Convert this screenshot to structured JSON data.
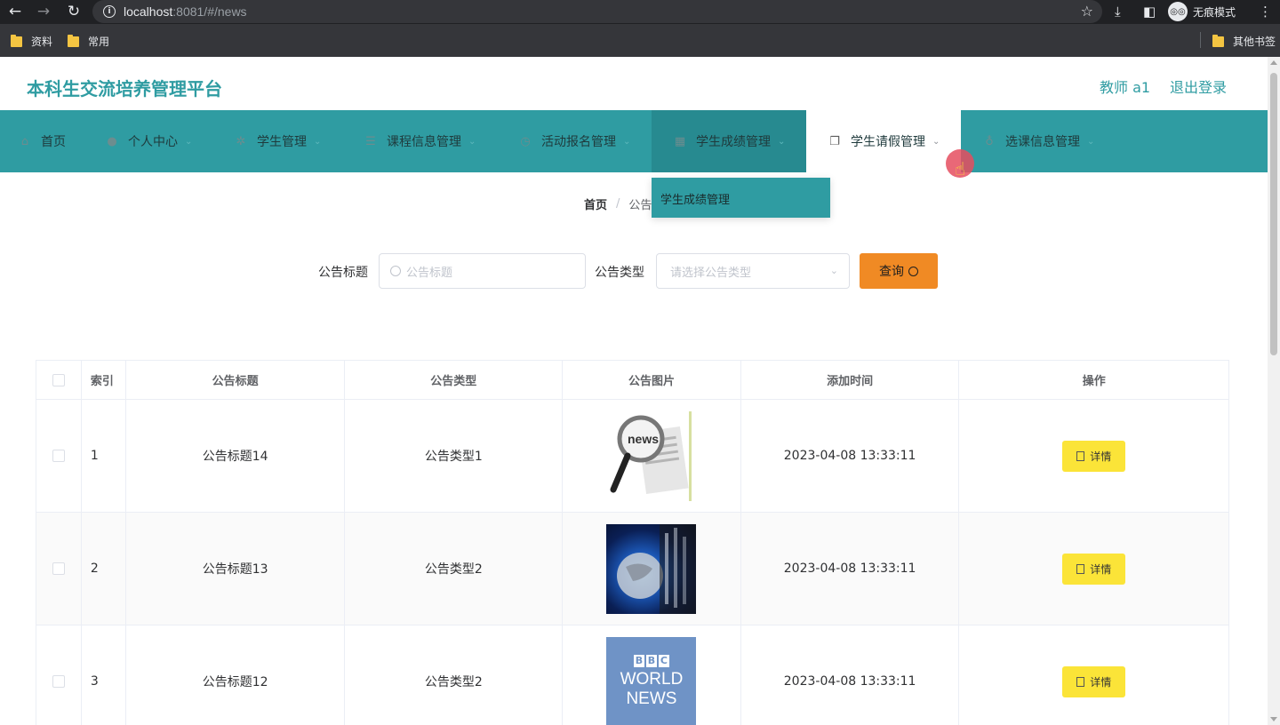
{
  "browser": {
    "url_host": "localhost",
    "url_port": ":8081/#/news",
    "incognito_label": "无痕模式",
    "bookmarks": [
      "资料",
      "常用"
    ],
    "other_bookmarks": "其他书签"
  },
  "header": {
    "site_title": "本科生交流培养管理平台",
    "user": "教师 a1",
    "logout": "退出登录"
  },
  "nav": {
    "items": [
      {
        "label": "首页",
        "icon": "home-icon"
      },
      {
        "label": "个人中心",
        "icon": "user-icon"
      },
      {
        "label": "学生管理",
        "icon": "compass-icon"
      },
      {
        "label": "课程信息管理",
        "icon": "list-icon"
      },
      {
        "label": "活动报名管理",
        "icon": "clock-icon"
      },
      {
        "label": "学生成绩管理",
        "icon": "grid-icon"
      },
      {
        "label": "学生请假管理",
        "icon": "copy-icon"
      },
      {
        "label": "选课信息管理",
        "icon": "mic-icon"
      }
    ],
    "dropdown_item": "学生成绩管理"
  },
  "breadcrumb": {
    "home": "首页",
    "sep": "/",
    "current": "公告"
  },
  "search": {
    "title_label": "公告标题",
    "title_placeholder": "公告标题",
    "type_label": "公告类型",
    "type_placeholder": "请选择公告类型",
    "query_button": "查询"
  },
  "table": {
    "headers": [
      "索引",
      "公告标题",
      "公告类型",
      "公告图片",
      "添加时间",
      "操作"
    ],
    "rows": [
      {
        "index": "1",
        "title": "公告标题14",
        "type": "公告类型1",
        "image": "news-magnifier",
        "time": "2023-04-08 13:33:11",
        "action": "详情"
      },
      {
        "index": "2",
        "title": "公告标题13",
        "type": "公告类型2",
        "image": "globe",
        "time": "2023-04-08 13:33:11",
        "action": "详情"
      },
      {
        "index": "3",
        "title": "公告标题12",
        "type": "公告类型2",
        "image": "bbc-world-news",
        "time": "2023-04-08 13:33:11",
        "action": "详情"
      }
    ],
    "bbc_letters": [
      "B",
      "B",
      "C"
    ],
    "bbc_line1": "WORLD",
    "bbc_line2": "NEWS",
    "news_paper_text": "news"
  },
  "colors": {
    "brand": "#2f9ca2",
    "query_button": "#f08a24",
    "detail_button": "#fbe438"
  }
}
